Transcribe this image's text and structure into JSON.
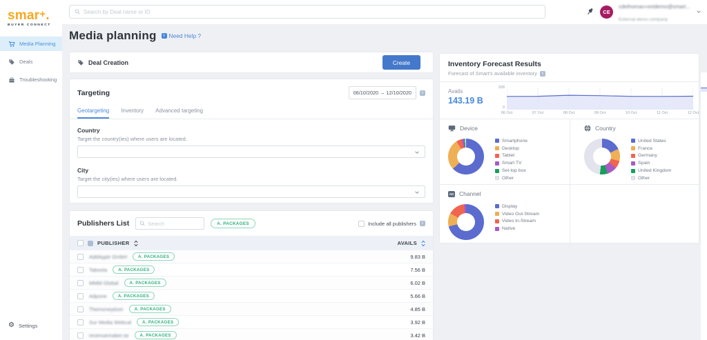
{
  "brand": {
    "logo_main": "smar",
    "logo_plus": "+",
    "logo_dot": ".",
    "tagline": "BUYER CONNECT"
  },
  "topbar": {
    "search_placeholder": "Search by Deal name or ID",
    "user": {
      "initials": "CE",
      "name": "cdethomas+extdemo@smart...",
      "company": "External demo company"
    }
  },
  "sidebar": {
    "items": [
      {
        "label": "Media Planning",
        "icon": "cart-icon",
        "active": true
      },
      {
        "label": "Deals",
        "icon": "tag-icon",
        "active": false
      },
      {
        "label": "Troubleshooting",
        "icon": "toolbox-icon",
        "active": false
      }
    ],
    "settings_label": "Settings"
  },
  "page": {
    "title": "Media planning",
    "help_label": "Need Help ?"
  },
  "deal_creation": {
    "title": "Deal Creation",
    "create_label": "Create"
  },
  "targeting": {
    "title": "Targeting",
    "date_range": "06/10/2020 → 12/10/2020",
    "tabs": [
      {
        "label": "Geotargeting",
        "active": true
      },
      {
        "label": "Inventory",
        "active": false
      },
      {
        "label": "Advanced targeting",
        "active": false
      }
    ],
    "fields": [
      {
        "label": "Country",
        "description": "Target the country(ies) where users are located."
      },
      {
        "label": "City",
        "description": "Target the city(ies) where users are located."
      }
    ]
  },
  "publishers": {
    "title": "Publishers List",
    "search_placeholder": "Search",
    "packages_badge": "A. PACKAGES",
    "include_all_label": "Include all publishers",
    "columns": {
      "publisher": "PUBLISHER",
      "avails": "AVAILS"
    },
    "rows": [
      {
        "name": "AddApptr GmbH",
        "badge": "A. PACKAGES",
        "avails": "9.83 B"
      },
      {
        "name": "Taboola",
        "badge": "A. PACKAGES",
        "avails": "7.56 B"
      },
      {
        "name": "MMM Global",
        "badge": "A. PACKAGES",
        "avails": "6.02 B"
      },
      {
        "name": "Adpone",
        "badge": "A. PACKAGES",
        "avails": "5.66 B"
      },
      {
        "name": "Themoneytizer",
        "badge": "A. PACKAGES",
        "avails": "4.85 B"
      },
      {
        "name": "Sur Media Webcal",
        "badge": "A. PACKAGES",
        "avails": "3.92 B"
      },
      {
        "name": "revenuemaker.se",
        "badge": "A. PACKAGES",
        "avails": "3.42 B"
      }
    ]
  },
  "forecast": {
    "title": "Inventory Forecast Results",
    "subtitle": "Forecast of Smart's available inventory",
    "avails_label": "Avails",
    "avails_value": "143.19 B"
  },
  "colors": {
    "accent_blue": "#4478cb",
    "link_blue": "#4a87d8",
    "avails_blue": "#4189dd",
    "badge_green": "#2fae80",
    "logo_orange": "#f8a81e",
    "avatar_magenta": "#a61b62",
    "sidebar_active_bg": "#dceefa"
  },
  "chart_data": [
    {
      "type": "area",
      "name": "Avails",
      "x": [
        "06 Oct",
        "07 Oct",
        "08 Oct",
        "09 Oct",
        "10 Oct",
        "11 Oct",
        "12 Oct"
      ],
      "values": [
        197,
        199,
        214,
        208,
        198,
        197,
        200
      ],
      "ylim": [
        0,
        328
      ],
      "yticks": [
        "328",
        "0"
      ],
      "grid": "vertical",
      "line_color": "#5b6cce",
      "fill_color": "#e1e5f8"
    },
    {
      "type": "pie",
      "title": "Device",
      "icon": "monitor-icon",
      "labels": [
        "Smartphone",
        "Desktop",
        "Tablet",
        "Smart TV",
        "Set-top box",
        "Other"
      ],
      "values": [
        63,
        28,
        5,
        2,
        1,
        1
      ],
      "colors": [
        "#5b6cce",
        "#efaf55",
        "#f0654f",
        "#a95ac4",
        "#16a05a",
        "#e2e3ec"
      ],
      "legend_position": "right"
    },
    {
      "type": "pie",
      "title": "Country",
      "icon": "globe-icon",
      "labels": [
        "United States",
        "France",
        "Germany",
        "Spain",
        "United Kingdom",
        "Other"
      ],
      "values": [
        18,
        11,
        7,
        9,
        7,
        48
      ],
      "colors": [
        "#5b6cce",
        "#efaf55",
        "#f0654f",
        "#a95ac4",
        "#16a05a",
        "#e2e3ec"
      ],
      "legend_position": "right"
    },
    {
      "type": "pie",
      "title": "Channel",
      "icon": "ad-icon",
      "labels": [
        "Display",
        "Video Out-Stream",
        "Video In-Stream",
        "Native"
      ],
      "values": [
        71,
        12,
        15,
        2
      ],
      "colors": [
        "#5b6cce",
        "#efaf55",
        "#f0654f",
        "#a95ac4"
      ],
      "legend_position": "right"
    }
  ]
}
